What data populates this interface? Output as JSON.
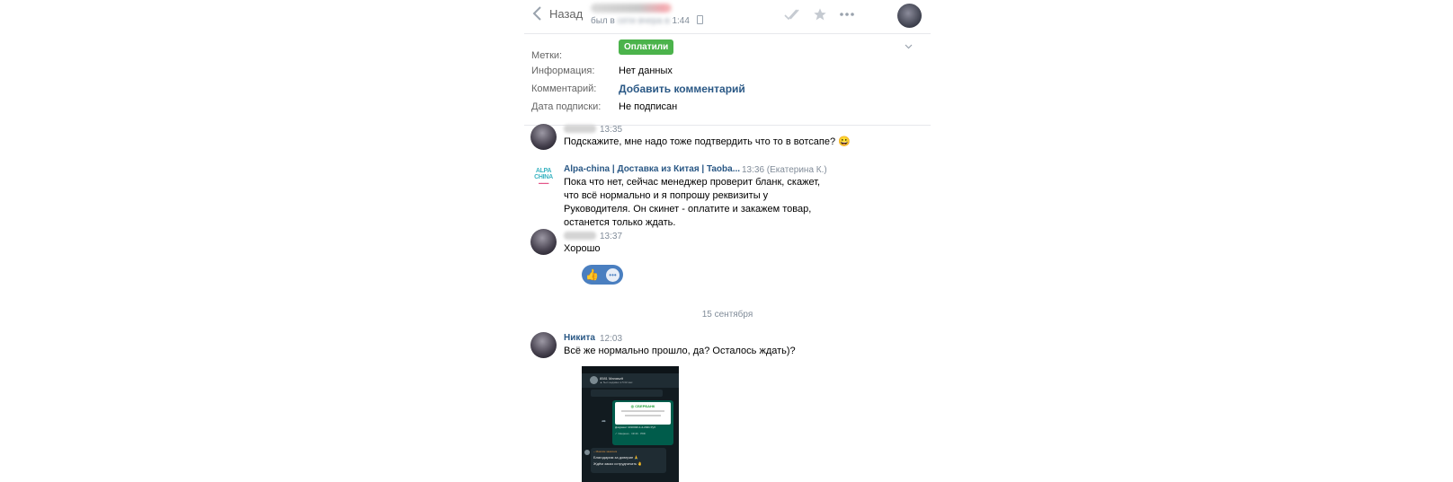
{
  "header": {
    "back_label": "Назад",
    "status_prefix": "был в",
    "status_hidden": "сети вчера в",
    "status_time": "1:44"
  },
  "info": {
    "tags_label": "Метки:",
    "tag": "Оплатили",
    "tag_color": "#4bb34b",
    "information_label": "Информация:",
    "information_value": "Нет данных",
    "comment_label": "Комментарий:",
    "comment_link": "Добавить комментарий",
    "subscription_label": "Дата подписки:",
    "subscription_value": "Не подписан"
  },
  "messages": [
    {
      "time": "13:35",
      "text": "Подскажите, мне надо тоже подтвердить что то в вотсапе? 😀"
    },
    {
      "author": "Alpa-china | Доставка из Китая | Taoba...",
      "time": "13:36 (Екатерина К.)",
      "text": "Пока что нет, сейчас менеджер проверит бланк, скажет, что всё нормально и я попрошу реквизиты у Руководителя. Он скинет - оплатите и закажем товар, останется только ждать."
    },
    {
      "time": "13:37",
      "text": "Хорошо"
    },
    {
      "author": "Никита",
      "time": "12:03",
      "text": "Всё же нормально прошло, да? Осталось ждать)?"
    }
  ],
  "alpa_logo": {
    "line1": "ALPA",
    "line2": "CHINA"
  },
  "reactions": {
    "emoji": "👍",
    "more": "•••"
  },
  "date_separator": "15 сентября",
  "attachment": {
    "contact": "8581 Manaszit",
    "contact_sub": "▲ был недавно в 5:02 вас",
    "brand": "◎ СБЕРБАНК",
    "doc": "Документ 1010430-1-2-2021 Руб",
    "doc_sub": "✓ Сверено · 19:44 · PDF",
    "sender": "~ Максим заказчик",
    "line1": "Благодарим за доверие 🙏",
    "line2": "Ждём заказ сотрудничать 🤚"
  },
  "colors": {
    "link": "#2a5885",
    "muted": "#818c99",
    "reaction_bg": "#4a7fc0"
  }
}
